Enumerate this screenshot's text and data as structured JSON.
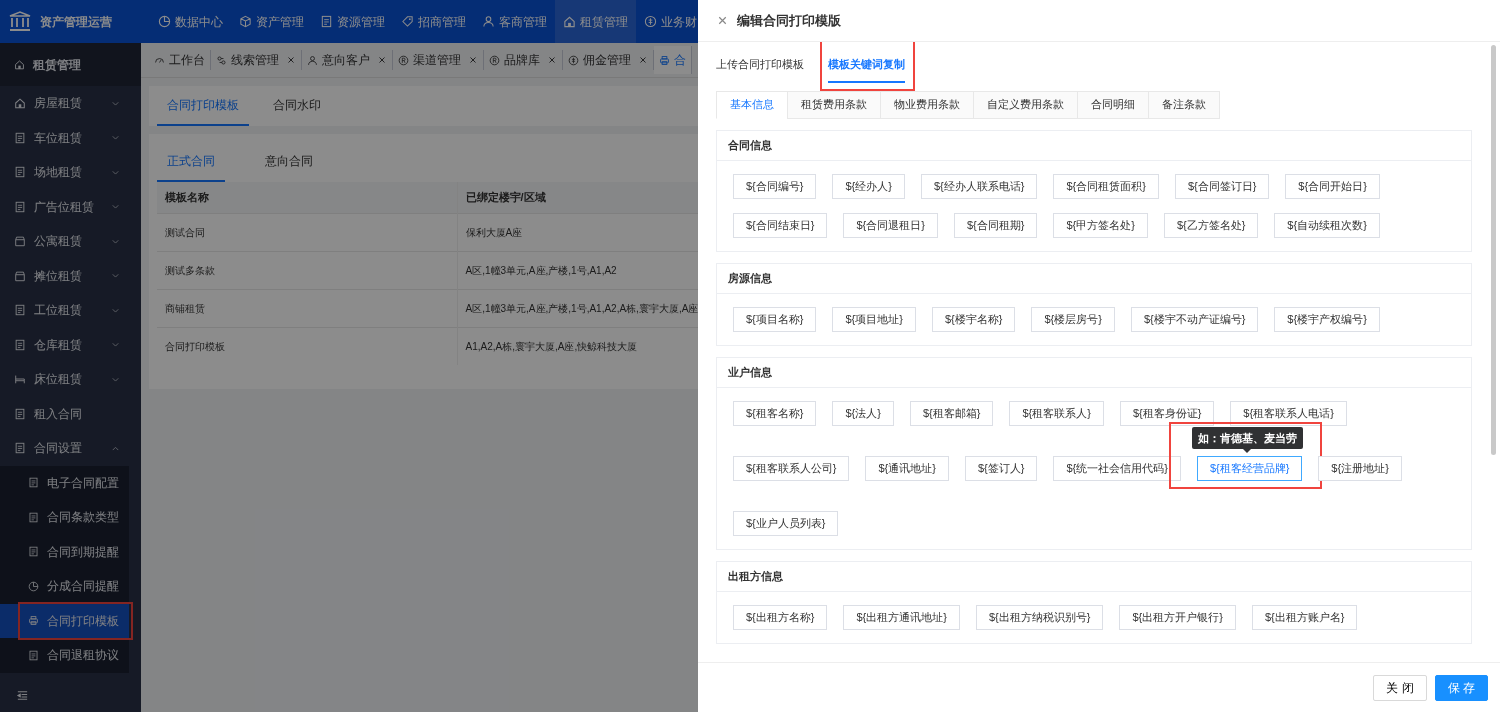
{
  "app": {
    "title": "资产管理运营"
  },
  "top_nav": [
    {
      "label": "数据中心",
      "selected": false
    },
    {
      "label": "资产管理",
      "selected": false
    },
    {
      "label": "资源管理",
      "selected": false
    },
    {
      "label": "招商管理",
      "selected": false
    },
    {
      "label": "客商管理",
      "selected": false
    },
    {
      "label": "租赁管理",
      "selected": true
    },
    {
      "label": "业务财",
      "selected": false
    }
  ],
  "sidebar": {
    "title": "租赁管理",
    "items": [
      {
        "label": "房屋租赁",
        "kind": "group",
        "expanded": false
      },
      {
        "label": "车位租赁",
        "kind": "group",
        "expanded": false
      },
      {
        "label": "场地租赁",
        "kind": "group",
        "expanded": false
      },
      {
        "label": "广告位租赁",
        "kind": "group",
        "expanded": false
      },
      {
        "label": "公寓租赁",
        "kind": "group",
        "expanded": false
      },
      {
        "label": "摊位租赁",
        "kind": "group",
        "expanded": false
      },
      {
        "label": "工位租赁",
        "kind": "group",
        "expanded": false
      },
      {
        "label": "仓库租赁",
        "kind": "group",
        "expanded": false
      },
      {
        "label": "床位租赁",
        "kind": "group",
        "expanded": false
      },
      {
        "label": "租入合同",
        "kind": "link"
      },
      {
        "label": "合同设置",
        "kind": "group",
        "expanded": true,
        "children": [
          {
            "label": "电子合同配置",
            "selected": false,
            "highlighted": false
          },
          {
            "label": "合同条款类型",
            "selected": false,
            "highlighted": false
          },
          {
            "label": "合同到期提醒",
            "selected": false,
            "highlighted": false
          },
          {
            "label": "分成合同提醒",
            "selected": false,
            "highlighted": false
          },
          {
            "label": "合同打印模板",
            "selected": true,
            "highlighted": true
          },
          {
            "label": "合同退租协议",
            "selected": false,
            "highlighted": false
          }
        ]
      }
    ]
  },
  "page_tabs": [
    {
      "label": "工作台",
      "closable": false,
      "selected": false
    },
    {
      "label": "线索管理",
      "closable": true,
      "selected": false
    },
    {
      "label": "意向客户",
      "closable": true,
      "selected": false
    },
    {
      "label": "渠道管理",
      "closable": true,
      "selected": false
    },
    {
      "label": "品牌库",
      "closable": true,
      "selected": false
    },
    {
      "label": "佣金管理",
      "closable": true,
      "selected": false
    },
    {
      "label": "合",
      "closable": false,
      "selected": true
    }
  ],
  "main": {
    "tabs": [
      {
        "label": "合同打印模板",
        "selected": true
      },
      {
        "label": "合同水印",
        "selected": false
      }
    ],
    "sub_tabs": [
      {
        "label": "正式合同",
        "selected": true
      },
      {
        "label": "意向合同",
        "selected": false
      }
    ],
    "table": {
      "columns": [
        "模板名称",
        "已绑定楼宇/区域"
      ],
      "rows": [
        [
          "测试合同",
          "保利大厦A座"
        ],
        [
          "测试多条款",
          "A区,1幢3单元,A座,产楼,1号,A1,A2"
        ],
        [
          "商铺租赁",
          "A区,1幢3单元,A座,产楼,1号,A1,A2,A栋,寰宇大厦,A座"
        ],
        [
          "合同打印模板",
          "A1,A2,A栋,寰宇大厦,A座,快鲸科技大厦"
        ]
      ]
    }
  },
  "drawer": {
    "title": "编辑合同打印模版",
    "mode_tabs": [
      {
        "label": "上传合同打印模板",
        "selected": false,
        "highlighted": false
      },
      {
        "label": "模板关键词复制",
        "selected": true,
        "highlighted": true
      }
    ],
    "section_tabs": [
      {
        "label": "基本信息",
        "selected": true
      },
      {
        "label": "租赁费用条款",
        "selected": false
      },
      {
        "label": "物业费用条款",
        "selected": false
      },
      {
        "label": "自定义费用条款",
        "selected": false
      },
      {
        "label": "合同明细",
        "selected": false
      },
      {
        "label": "备注条款",
        "selected": false
      }
    ],
    "sections": [
      {
        "title": "合同信息",
        "keywords": [
          {
            "text": "${合同编号}",
            "hovered": false
          },
          {
            "text": "${经办人}",
            "hovered": false
          },
          {
            "text": "${经办人联系电话}",
            "hovered": false
          },
          {
            "text": "${合同租赁面积}",
            "hovered": false
          },
          {
            "text": "${合同签订日}",
            "hovered": false
          },
          {
            "text": "${合同开始日}",
            "hovered": false
          },
          {
            "text": "${合同结束日}",
            "hovered": false
          },
          {
            "text": "${合同退租日}",
            "hovered": false
          },
          {
            "text": "${合同租期}",
            "hovered": false
          },
          {
            "text": "${甲方签名处}",
            "hovered": false
          },
          {
            "text": "${乙方签名处}",
            "hovered": false
          },
          {
            "text": "${自动续租次数}",
            "hovered": false
          }
        ]
      },
      {
        "title": "房源信息",
        "keywords": [
          {
            "text": "${项目名称}",
            "hovered": false
          },
          {
            "text": "${项目地址}",
            "hovered": false
          },
          {
            "text": "${楼宇名称}",
            "hovered": false
          },
          {
            "text": "${楼层房号}",
            "hovered": false
          },
          {
            "text": "${楼宇不动产证编号}",
            "hovered": false
          },
          {
            "text": "${楼宇产权编号}",
            "hovered": false
          }
        ]
      },
      {
        "title": "业户信息",
        "keywords": [
          {
            "text": "${租客名称}",
            "hovered": false
          },
          {
            "text": "${法人}",
            "hovered": false
          },
          {
            "text": "${租客邮箱}",
            "hovered": false
          },
          {
            "text": "${租客联系人}",
            "hovered": false
          },
          {
            "text": "${租客身份证}",
            "hovered": false
          },
          {
            "text": "${租客联系人电话}",
            "hovered": false
          },
          {
            "text": "${租客联系人公司}",
            "hovered": false
          },
          {
            "text": "${通讯地址}",
            "hovered": false
          },
          {
            "text": "${签订人}",
            "hovered": false
          },
          {
            "text": "${统一社会信用代码}",
            "hovered": false
          },
          {
            "text": "${租客经营品牌}",
            "hovered": true,
            "tooltip": "如：肯德基、麦当劳"
          },
          {
            "text": "${注册地址}",
            "hovered": false
          },
          {
            "text": "${业户人员列表}",
            "hovered": false
          }
        ]
      },
      {
        "title": "出租方信息",
        "keywords": [
          {
            "text": "${出租方名称}",
            "hovered": false
          },
          {
            "text": "${出租方通讯地址}",
            "hovered": false
          },
          {
            "text": "${出租方纳税识别号}",
            "hovered": false
          },
          {
            "text": "${出租方开户银行}",
            "hovered": false
          },
          {
            "text": "${出租方账户名}",
            "hovered": false
          }
        ]
      }
    ],
    "buttons": [
      {
        "label": "关 闭",
        "kind": "default"
      },
      {
        "label": "保 存",
        "kind": "primary"
      }
    ]
  }
}
